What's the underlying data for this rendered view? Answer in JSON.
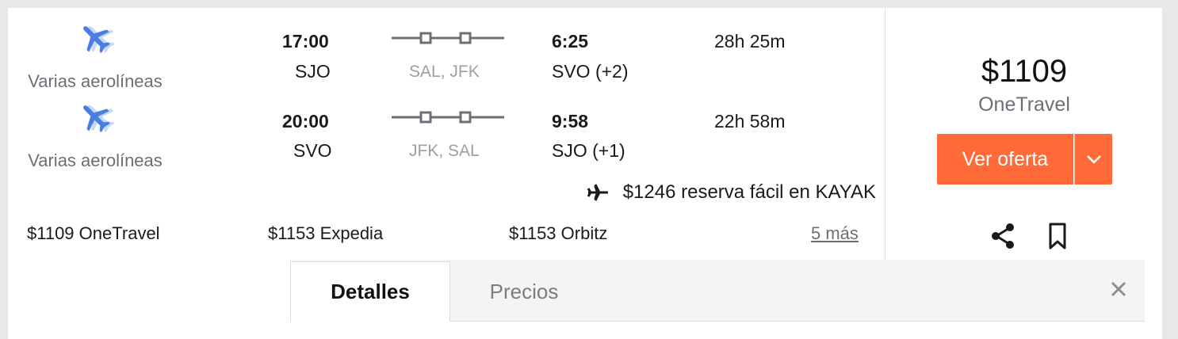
{
  "outbound": {
    "airline": "Varias aerolíneas",
    "depart_time": "17:00",
    "depart_airport": "SJO",
    "stops": "SAL, JFK",
    "arrive_time": "6:25",
    "arrive_airport": "SVO (+2)",
    "duration": "28h 25m"
  },
  "return": {
    "airline": "Varias aerolíneas",
    "depart_time": "20:00",
    "depart_airport": "SVO",
    "stops": "JFK, SAL",
    "arrive_time": "9:58",
    "arrive_airport": "SJO (+1)",
    "duration": "22h 58m"
  },
  "kayak_offer": "$1246 reserva fácil en KAYAK",
  "providers": [
    {
      "price": "$1109",
      "name": "OneTravel"
    },
    {
      "price": "$1153",
      "name": "Expedia"
    },
    {
      "price": "$1153",
      "name": "Orbitz"
    }
  ],
  "more_link": "5 más",
  "price_panel": {
    "price": "$1109",
    "provider": "OneTravel",
    "deal_button": "Ver oferta"
  },
  "tabs": [
    {
      "label": "Detalles",
      "active": true
    },
    {
      "label": "Precios",
      "active": false
    }
  ],
  "colors": {
    "accent": "#ff6a38",
    "plane": "#4a7fe0",
    "muted": "#6c6f76"
  },
  "icons": [
    "plane-icon",
    "arrow-plane-icon",
    "chevron-down-icon",
    "share-icon",
    "bookmark-icon",
    "close-icon"
  ]
}
